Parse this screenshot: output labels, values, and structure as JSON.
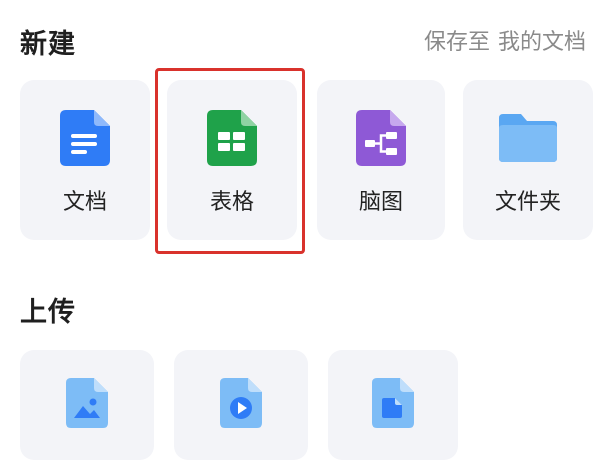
{
  "new_section": {
    "title": "新建",
    "save_to_label": "保存至",
    "save_to_location": "我的文档",
    "items": [
      {
        "label": "文档",
        "icon": "doc-icon",
        "color": "#2f7cf6"
      },
      {
        "label": "表格",
        "icon": "sheet-icon",
        "color": "#1fa24a"
      },
      {
        "label": "脑图",
        "icon": "mindmap-icon",
        "color": "#8e59d6"
      },
      {
        "label": "文件夹",
        "icon": "folder-icon",
        "color": "#5aa7f2"
      }
    ]
  },
  "upload_section": {
    "title": "上传",
    "items": [
      {
        "icon": "image-file-icon",
        "color": "#5aa7f2"
      },
      {
        "icon": "video-file-icon",
        "color": "#2f7cf6"
      },
      {
        "icon": "file-icon",
        "color": "#2f7cf6"
      }
    ]
  },
  "highlighted_item": "表格"
}
